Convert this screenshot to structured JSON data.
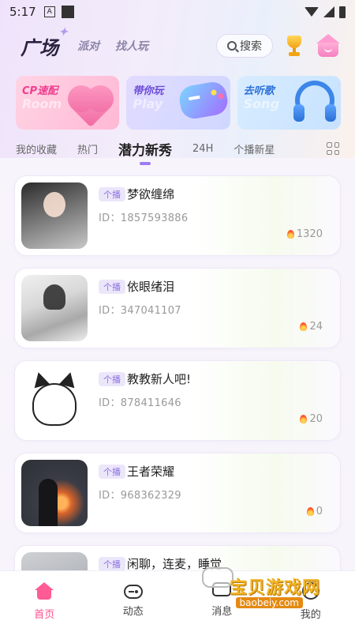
{
  "status_bar": {
    "time": "5:17",
    "a_icon_letter": "A"
  },
  "header": {
    "logo": "广场",
    "tabs": [
      {
        "label": "派对"
      },
      {
        "label": "找人玩"
      }
    ],
    "search_label": "搜索"
  },
  "banners": [
    {
      "title": "CP速配",
      "ghost": "Room"
    },
    {
      "title": "带你玩",
      "ghost": "Play"
    },
    {
      "title": "去听歌",
      "ghost": "Song"
    }
  ],
  "category_tabs": [
    {
      "label": "我的收藏",
      "active": false
    },
    {
      "label": "热门",
      "active": false
    },
    {
      "label": "潜力新秀",
      "active": true
    },
    {
      "label": "24H",
      "active": false
    },
    {
      "label": "个播新星",
      "active": false
    }
  ],
  "rooms": [
    {
      "badge": "个播",
      "name": "梦欲缠绵",
      "id": "ID：1857593886",
      "hot": "1320"
    },
    {
      "badge": "个播",
      "name": "依眼绪泪",
      "id": "ID：347041107",
      "hot": "24"
    },
    {
      "badge": "个播",
      "name": "教教新人吧!",
      "id": "ID：878411646",
      "hot": "20"
    },
    {
      "badge": "个播",
      "name": "王者荣耀",
      "id": "ID：968362329",
      "hot": "0"
    },
    {
      "badge": "个播",
      "name": "闲聊，连麦，睡觉",
      "id": "",
      "hot": ""
    }
  ],
  "bottom_nav": [
    {
      "label": "首页",
      "active": true
    },
    {
      "label": "动态",
      "active": false
    },
    {
      "label": "消息",
      "active": false
    },
    {
      "label": "我的",
      "active": false
    }
  ],
  "watermark": {
    "text": "宝贝游戏网",
    "url": "baobeiy.com"
  },
  "colors": {
    "accent": "#9c7cf0",
    "active_nav": "#ff4d8d",
    "badge_bg": "#ece6fb",
    "badge_text": "#8b72e0"
  }
}
